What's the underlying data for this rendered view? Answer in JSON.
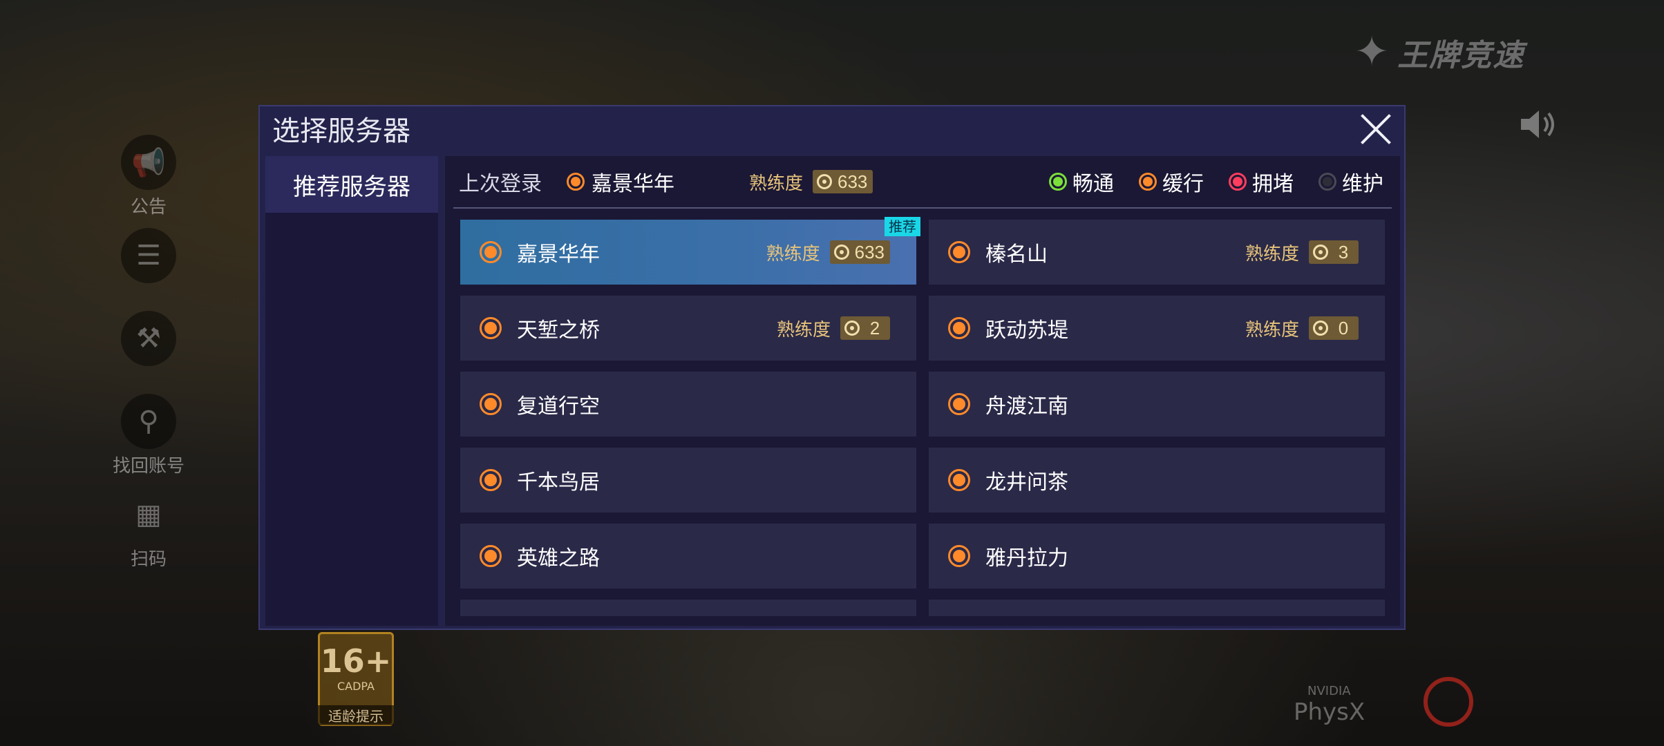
{
  "background": {
    "side_menu": [
      "公告",
      "",
      "",
      "找回账号",
      "扫码"
    ],
    "game_logo": "王牌竞速",
    "age_badge": {
      "number": "16+",
      "org": "CADPA",
      "label": "适龄提示"
    },
    "physx": {
      "brand": "NVIDIA",
      "name": "PhysX"
    }
  },
  "dialog": {
    "title": "选择服务器",
    "close_icon": "close-icon",
    "tabs": [
      {
        "label": "推荐服务器",
        "selected": true
      }
    ],
    "last_login": {
      "label": "上次登录",
      "server": "嘉景华年",
      "proficiency_label": "熟练度",
      "proficiency_value": "633"
    },
    "legend": [
      {
        "label": "畅通",
        "color": "#7be03a"
      },
      {
        "label": "缓行",
        "color": "#ff8a2a"
      },
      {
        "label": "拥堵",
        "color": "#ff3d5e"
      },
      {
        "label": "维护",
        "color": "#4a4a55"
      }
    ],
    "servers": [
      {
        "name": "嘉景华年",
        "proficiency_label": "熟练度",
        "proficiency": "633",
        "tag": "推荐",
        "selected": true
      },
      {
        "name": "榛名山",
        "proficiency_label": "熟练度",
        "proficiency": "3"
      },
      {
        "name": "天堑之桥",
        "proficiency_label": "熟练度",
        "proficiency": "2"
      },
      {
        "name": "跃动苏堤",
        "proficiency_label": "熟练度",
        "proficiency": "0"
      },
      {
        "name": "复道行空"
      },
      {
        "name": "舟渡江南"
      },
      {
        "name": "千本鸟居"
      },
      {
        "name": "龙井问茶"
      },
      {
        "name": "英雄之路"
      },
      {
        "name": "雅丹拉力"
      }
    ]
  }
}
